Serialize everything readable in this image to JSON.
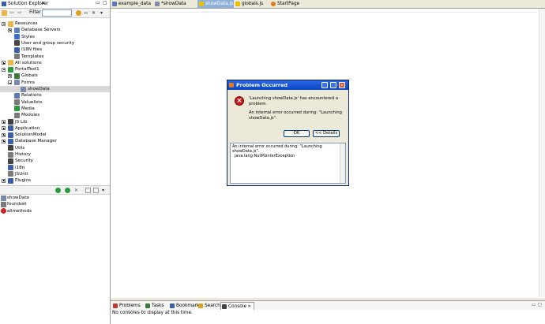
{
  "explorer": {
    "title": "Solution Explorer",
    "filter_label": "Filter",
    "filter_value": "",
    "tree": [
      {
        "label": "Resources",
        "indent": 0,
        "expander": "minus",
        "icon": "folder-icon",
        "color": "#e8b84a"
      },
      {
        "label": "Database Servers",
        "indent": 1,
        "expander": "plus",
        "icon": "database-icon",
        "color": "#5b7fbf"
      },
      {
        "label": "Styles",
        "indent": 1,
        "expander": "",
        "icon": "styles-icon",
        "color": "#3a6fc9"
      },
      {
        "label": "User and group security",
        "indent": 1,
        "expander": "",
        "icon": "lock-icon",
        "color": "#444444"
      },
      {
        "label": "I18N files",
        "indent": 1,
        "expander": "",
        "icon": "i18n-icon",
        "color": "#3c5fa8"
      },
      {
        "label": "Templates",
        "indent": 1,
        "expander": "",
        "icon": "template-icon",
        "color": "#7a7a7a"
      },
      {
        "label": "All solutions",
        "indent": 0,
        "expander": "plus",
        "icon": "folder-icon",
        "color": "#e8b84a"
      },
      {
        "label": "PortalTest1",
        "indent": 0,
        "expander": "minus",
        "icon": "solution-icon",
        "color": "#2c9a3c"
      },
      {
        "label": "Globals",
        "indent": 1,
        "expander": "plus",
        "icon": "globals-icon",
        "color": "#3c7a3c"
      },
      {
        "label": "Forms",
        "indent": 1,
        "expander": "minus",
        "icon": "forms-icon",
        "color": "#7a8aa8"
      },
      {
        "label": "showData",
        "indent": 2,
        "expander": "",
        "icon": "form-icon",
        "color": "#7a8aa8",
        "selected": true
      },
      {
        "label": "Relations",
        "indent": 1,
        "expander": "",
        "icon": "relations-icon",
        "color": "#5a7ab8"
      },
      {
        "label": "Valuelists",
        "indent": 1,
        "expander": "",
        "icon": "valuelist-icon",
        "color": "#7a7a7a"
      },
      {
        "label": "Media",
        "indent": 1,
        "expander": "",
        "icon": "media-icon",
        "color": "#2c9a3c"
      },
      {
        "label": "Modules",
        "indent": 1,
        "expander": "",
        "icon": "modules-icon",
        "color": "#7a7a7a"
      },
      {
        "label": "JS Lib",
        "indent": 0,
        "expander": "plus",
        "icon": "jslib-icon",
        "color": "#404040"
      },
      {
        "label": "Application",
        "indent": 0,
        "expander": "plus",
        "icon": "application-icon",
        "color": "#3c5fa8"
      },
      {
        "label": "SolutionModel",
        "indent": 0,
        "expander": "plus",
        "icon": "solutionmodel-icon",
        "color": "#3c5fa8"
      },
      {
        "label": "Database Manager",
        "indent": 0,
        "expander": "plus",
        "icon": "dbmanager-icon",
        "color": "#3c5fa8"
      },
      {
        "label": "Utils",
        "indent": 0,
        "expander": "",
        "icon": "utils-icon",
        "color": "#404040"
      },
      {
        "label": "History",
        "indent": 0,
        "expander": "",
        "icon": "history-icon",
        "color": "#7a7a7a"
      },
      {
        "label": "Security",
        "indent": 0,
        "expander": "",
        "icon": "security-icon",
        "color": "#444444"
      },
      {
        "label": "i18n",
        "indent": 0,
        "expander": "",
        "icon": "i18n-icon",
        "color": "#3c5fa8"
      },
      {
        "label": "JSUnit",
        "indent": 0,
        "expander": "",
        "icon": "jsunit-icon",
        "color": "#7a7a7a"
      },
      {
        "label": "Plugins",
        "indent": 0,
        "expander": "plus",
        "icon": "plugins-icon",
        "color": "#3c5fa8"
      }
    ],
    "outline": [
      {
        "label": "showData",
        "icon": "form-icon",
        "color": "#7a8aa8"
      },
      {
        "label": "foundset",
        "icon": "foundset-icon",
        "color": "#7a7a7a"
      },
      {
        "label": "allmethods",
        "icon": "methods-icon",
        "color": "#cc2222"
      }
    ]
  },
  "editor_tabs": [
    {
      "label": "example_data",
      "icon": "file-icon",
      "color": "#5a7ab8",
      "active": false
    },
    {
      "label": "*showData",
      "icon": "form-icon",
      "color": "#7a8aa8",
      "active": false
    },
    {
      "label": "showData.js",
      "icon": "js-icon",
      "color": "#e6c000",
      "active": true
    },
    {
      "label": "globals.js",
      "icon": "js-icon",
      "color": "#e6c000",
      "active": false
    },
    {
      "label": "StartPage",
      "icon": "servoy-icon",
      "color": "#e07a1a",
      "active": false
    }
  ],
  "bottom_tabs": [
    {
      "label": "Problems",
      "icon": "problems-icon",
      "color": "#cc3333",
      "active": false
    },
    {
      "label": "Tasks",
      "icon": "tasks-icon",
      "color": "#3c7a3c",
      "active": false
    },
    {
      "label": "Bookmarks",
      "icon": "bookmark-icon",
      "color": "#3c5fa8",
      "active": false
    },
    {
      "label": "Search",
      "icon": "search-icon",
      "color": "#e0a020",
      "active": false
    },
    {
      "label": "Console",
      "icon": "console-icon",
      "color": "#404040",
      "active": true
    }
  ],
  "console_message": "No consoles to display at this time.",
  "dialog": {
    "title": "Problem Occurred",
    "message_line1": "'Launching showData.js' has encountered a",
    "message_line2": "problem.",
    "error_line1": "An internal error occurred during: \"Launching",
    "error_line2": "showData.js\".",
    "ok_label": "OK",
    "details_label": "<< Details",
    "details_line1": "An internal error occurred during: \"Launching",
    "details_line2": "showData.js\".",
    "details_line3": "java.lang.NullPointerException"
  }
}
